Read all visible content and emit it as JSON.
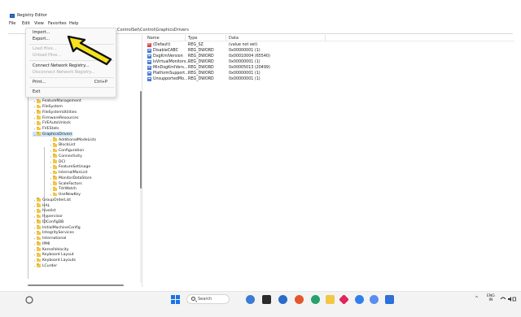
{
  "window": {
    "title": "Registry Editor",
    "menu": [
      "File",
      "Edit",
      "View",
      "Favorites",
      "Help"
    ],
    "address": "ControlSet\\Control\\GraphicsDrivers"
  },
  "file_menu": {
    "items": [
      {
        "label": "Import...",
        "disabled": false
      },
      {
        "label": "Export...",
        "disabled": false
      },
      {
        "label": "Load Hive...",
        "disabled": true
      },
      {
        "label": "Unload Hive...",
        "disabled": true
      },
      {
        "label": "Connect Network Registry...",
        "disabled": false
      },
      {
        "label": "Disconnect Network Registry...",
        "disabled": true
      },
      {
        "label": "Print...",
        "disabled": false,
        "shortcut": "Ctrl+P"
      },
      {
        "label": "Exit",
        "disabled": false
      }
    ]
  },
  "values": {
    "columns": [
      "Name",
      "Type",
      "Data"
    ],
    "rows": [
      {
        "icon": "string-value-icon",
        "name": "(Default)",
        "type": "REG_SZ",
        "data": "(value not set)"
      },
      {
        "icon": "dword-value-icon",
        "name": "DisableCABC",
        "type": "REG_DWORD",
        "data": "0x00000001 (1)"
      },
      {
        "icon": "dword-value-icon",
        "name": "DxgKrnlVersion",
        "type": "REG_DWORD",
        "data": "0x00010004 (65540)"
      },
      {
        "icon": "dword-value-icon",
        "name": "IsVirtualMonitors...",
        "type": "REG_DWORD",
        "data": "0x00000001 (1)"
      },
      {
        "icon": "dword-value-icon",
        "name": "MinDxgKrnlVers...",
        "type": "REG_DWORD",
        "data": "0x00005013 (20499)"
      },
      {
        "icon": "dword-value-icon",
        "name": "PlatformSupport...",
        "type": "REG_DWORD",
        "data": "0x00000001 (1)"
      },
      {
        "icon": "dword-value-icon",
        "name": "UnsupportedMo...",
        "type": "REG_DWORD",
        "data": "0x00000001 (1)"
      }
    ]
  },
  "tree": {
    "items": [
      {
        "label": "CrSKB",
        "level": 0,
        "selected": false
      },
      {
        "label": "FeatureManagement",
        "level": 0,
        "selected": false
      },
      {
        "label": "FileSystem",
        "level": 0,
        "selected": false
      },
      {
        "label": "FileSystemUtilities",
        "level": 0,
        "selected": false
      },
      {
        "label": "FirmwareResources",
        "level": 0,
        "selected": false
      },
      {
        "label": "FVEAutoUnlock",
        "level": 0,
        "selected": false
      },
      {
        "label": "FVEStats",
        "level": 0,
        "selected": false
      },
      {
        "label": "GraphicsDrivers",
        "level": 0,
        "selected": true
      },
      {
        "label": "AdditionalModeLists",
        "level": 1,
        "selected": false
      },
      {
        "label": "BlockList",
        "level": 1,
        "selected": false
      },
      {
        "label": "Configuration",
        "level": 1,
        "selected": false
      },
      {
        "label": "Connectivity",
        "level": 1,
        "selected": false
      },
      {
        "label": "DCI",
        "level": 1,
        "selected": false
      },
      {
        "label": "FeatureSetUsage",
        "level": 1,
        "selected": false
      },
      {
        "label": "InternalMonList",
        "level": 1,
        "selected": false
      },
      {
        "label": "MonitorDataStore",
        "level": 1,
        "selected": false
      },
      {
        "label": "ScaleFactors",
        "level": 1,
        "selected": false
      },
      {
        "label": "TdrWatch",
        "level": 1,
        "selected": false
      },
      {
        "label": "UseNewKey",
        "level": 1,
        "selected": false
      },
      {
        "label": "GroupOrderList",
        "level": 0,
        "selected": false
      },
      {
        "label": "HAL",
        "level": 0,
        "selected": false
      },
      {
        "label": "hivelist",
        "level": 0,
        "selected": false
      },
      {
        "label": "Hypervisor",
        "level": 0,
        "selected": false
      },
      {
        "label": "IDConfigDB",
        "level": 0,
        "selected": false
      },
      {
        "label": "InitialMachineConfig",
        "level": 0,
        "selected": false
      },
      {
        "label": "IntegrityServices",
        "level": 0,
        "selected": false
      },
      {
        "label": "International",
        "level": 0,
        "selected": false
      },
      {
        "label": "IPMI",
        "level": 0,
        "selected": false
      },
      {
        "label": "KernelVelocity",
        "level": 0,
        "selected": false
      },
      {
        "label": "Keyboard Layout",
        "level": 0,
        "selected": false
      },
      {
        "label": "Keyboard Layouts",
        "level": 0,
        "selected": false
      },
      {
        "label": "LCurder",
        "level": 0,
        "selected": false
      }
    ]
  },
  "taskbar": {
    "search_label": "Search",
    "tray_lang_line1": "ENG",
    "tray_lang_line2": "IN"
  },
  "colors": {
    "selection": "#cce4f7",
    "folder": "#f3c745",
    "arrow_fill": "#f5e21b",
    "arrow_stroke": "#111111"
  }
}
